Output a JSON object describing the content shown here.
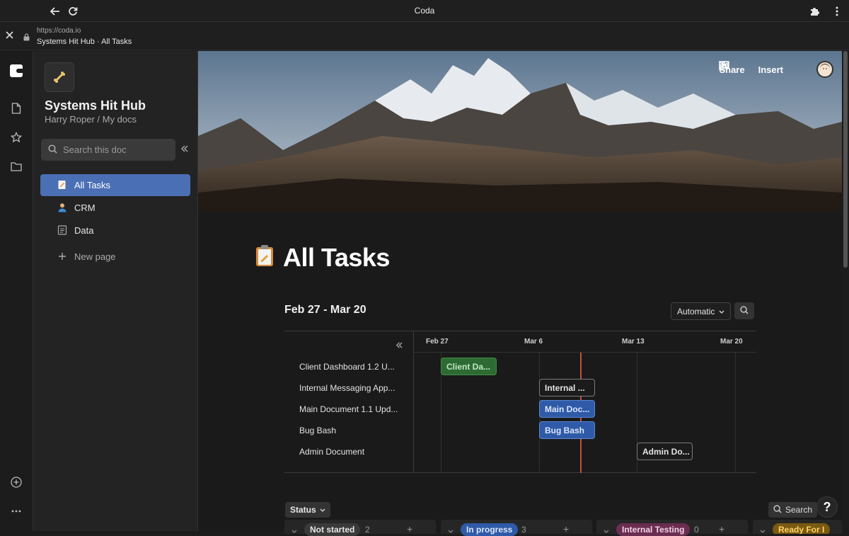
{
  "browser": {
    "window_title": "Coda",
    "url": "https://coda.io",
    "page_title": "Systems Hit Hub · All Tasks"
  },
  "sidebar": {
    "doc_title": "Systems Hit Hub",
    "doc_path": "Harry Roper / My docs",
    "search_placeholder": "Search this doc",
    "items": [
      {
        "label": "All Tasks",
        "icon": "notepad-icon",
        "active": true
      },
      {
        "label": "CRM",
        "icon": "person-icon",
        "active": false
      },
      {
        "label": "Data",
        "icon": "document-icon",
        "active": false
      }
    ],
    "new_page_label": "New page"
  },
  "header": {
    "share_label": "Share",
    "insert_label": "Insert"
  },
  "page": {
    "title": "All Tasks",
    "date_range": "Feb 27 - Mar 20",
    "view_mode": "Automatic"
  },
  "gantt": {
    "dates": [
      "Feb 27",
      "Mar 6",
      "Mar 13",
      "Mar 20"
    ],
    "rows": [
      {
        "label": "Client Dashboard 1.2 U...",
        "bar": "Client Da...",
        "style": "green"
      },
      {
        "label": "Internal Messaging App...",
        "bar": "Internal ...",
        "style": "dark"
      },
      {
        "label": "Main Document 1.1 Upd...",
        "bar": "Main Doc...",
        "style": "blue"
      },
      {
        "label": "Bug Bash",
        "bar": "Bug Bash",
        "style": "blue"
      },
      {
        "label": "Admin Document",
        "bar": "Admin Do...",
        "style": "dark"
      }
    ]
  },
  "board": {
    "group_by_label": "Status",
    "search_label": "Search",
    "help_label": "?",
    "lanes": [
      {
        "label": "Not started",
        "count": "2",
        "color": "#3a3a3b",
        "text": "#e6e6e6"
      },
      {
        "label": "In progress",
        "count": "3",
        "color": "#2f5aa8",
        "text": "#dbe6fb"
      },
      {
        "label": "Internal Testing",
        "count": "0",
        "color": "#6b2d52",
        "text": "#f3d3e6"
      },
      {
        "label": "Ready For I",
        "count": "",
        "color": "#7a5a10",
        "text": "#ffd36a"
      }
    ]
  },
  "colors": {
    "accent": "#4a6fb5",
    "today_line": "#c0553a"
  }
}
